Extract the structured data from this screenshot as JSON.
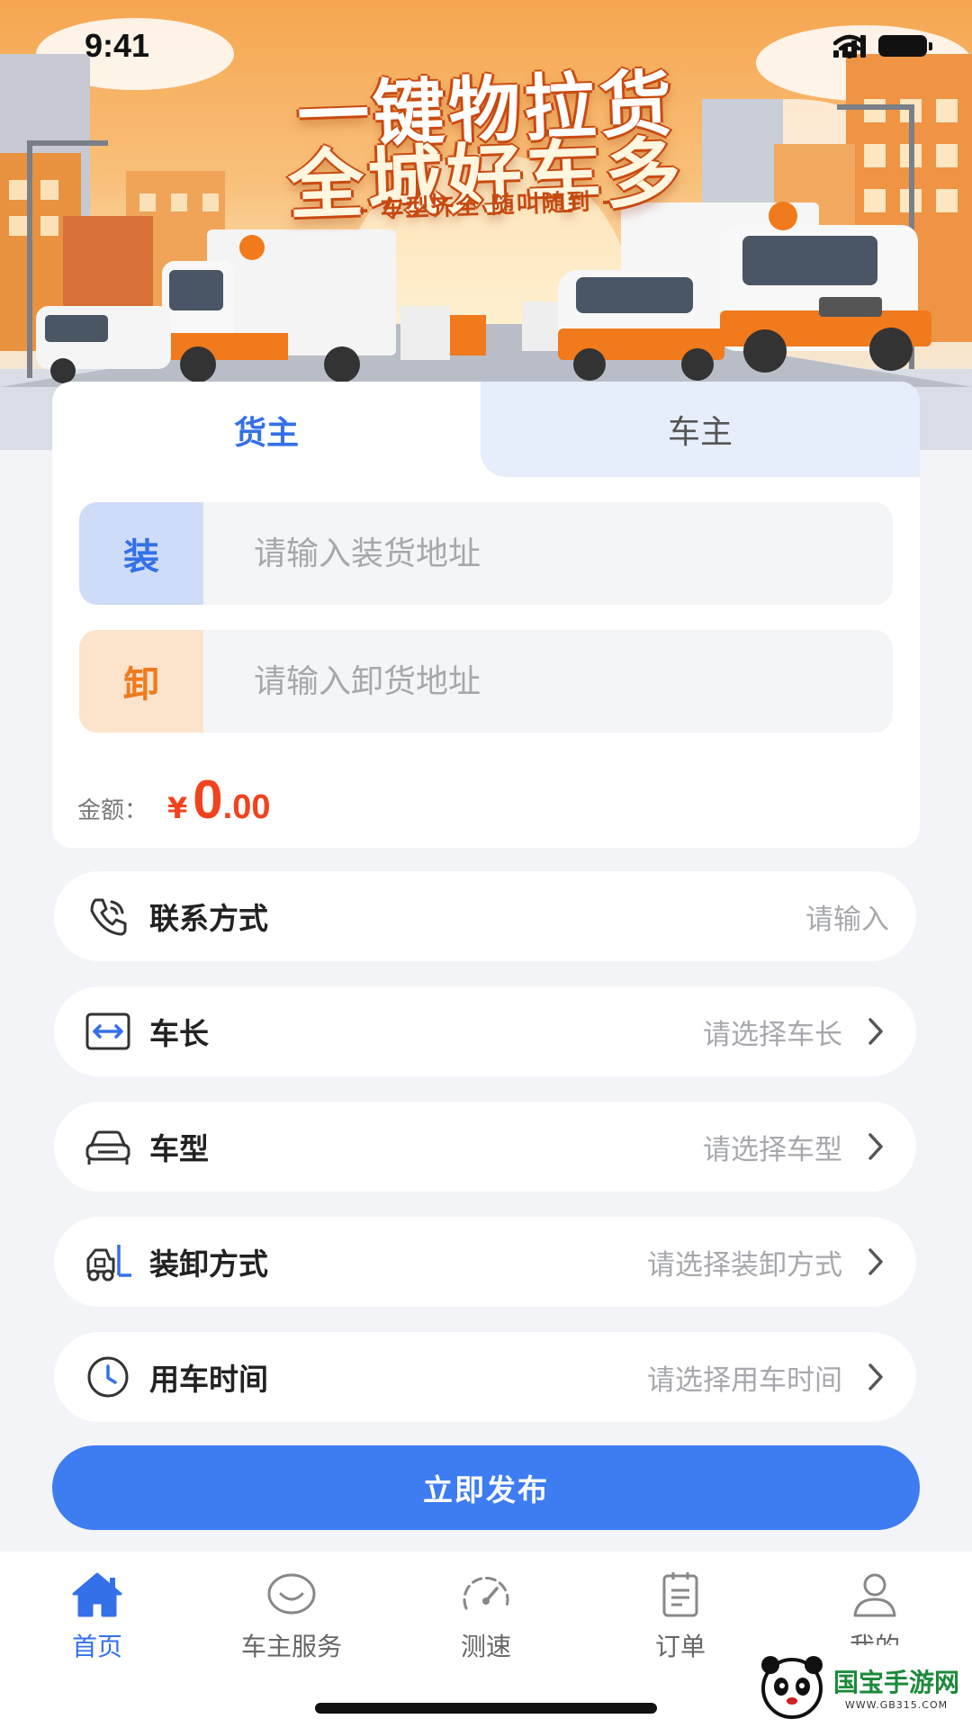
{
  "status_bar": {
    "time": "9:41"
  },
  "banner": {
    "title_line1": "一键物拉货",
    "title_line2": "全城好车多",
    "subtitle": "- 车型齐全 随叫随到 -"
  },
  "tabs": [
    {
      "label": "货主",
      "active": true
    },
    {
      "label": "车主",
      "active": false
    }
  ],
  "address": {
    "load": {
      "badge": "装",
      "placeholder": "请输入装货地址",
      "value": ""
    },
    "unload": {
      "badge": "卸",
      "placeholder": "请输入卸货地址",
      "value": ""
    }
  },
  "amount": {
    "label": "金额：",
    "currency": "¥",
    "integer": "0",
    "decimal": ".00"
  },
  "form_rows": [
    {
      "label": "联系方式",
      "value": "请输入",
      "icon": "phone-icon",
      "has_chevron": false
    },
    {
      "label": "车长",
      "value": "请选择车长",
      "icon": "arrows-horizontal-icon",
      "has_chevron": true
    },
    {
      "label": "车型",
      "value": "请选择车型",
      "icon": "car-icon",
      "has_chevron": true
    },
    {
      "label": "装卸方式",
      "value": "请选择装卸方式",
      "icon": "forklift-icon",
      "has_chevron": true
    },
    {
      "label": "用车时间",
      "value": "请选择用车时间",
      "icon": "clock-icon",
      "has_chevron": true
    }
  ],
  "publish_button": "立即发布",
  "bottom_nav": [
    {
      "label": "首页",
      "icon": "home-icon",
      "active": true
    },
    {
      "label": "车主服务",
      "icon": "chat-bubble-icon",
      "active": false
    },
    {
      "label": "测速",
      "icon": "speedometer-icon",
      "active": false
    },
    {
      "label": "订单",
      "icon": "clipboard-icon",
      "active": false
    },
    {
      "label": "我的",
      "icon": "user-icon",
      "active": false
    }
  ],
  "watermark": {
    "text": "国宝手游网",
    "url": "WWW.GB315.COM"
  },
  "colors": {
    "primary": "#3d7cf1",
    "accent_orange": "#f07a1c",
    "price_red": "#f0431e",
    "background": "#f3f4f7"
  }
}
